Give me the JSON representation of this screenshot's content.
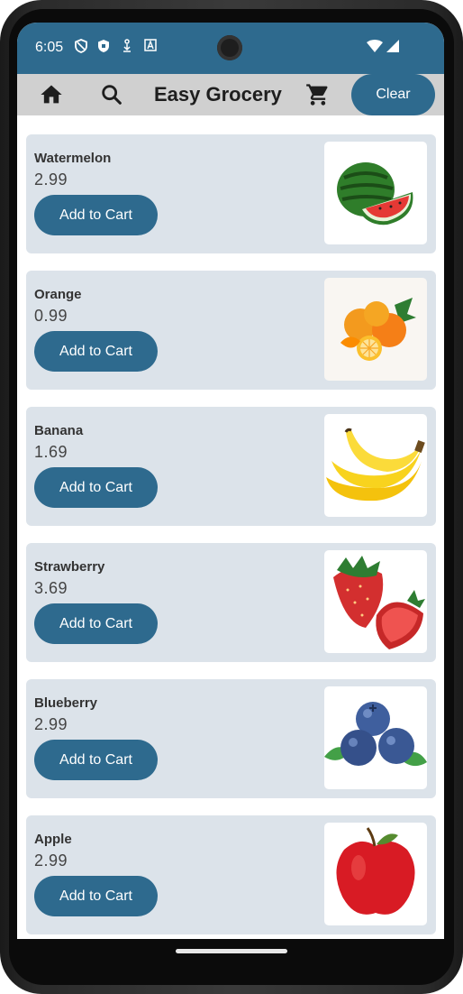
{
  "status_bar": {
    "time": "6:05"
  },
  "app_bar": {
    "title": "Easy Grocery",
    "clear_label": "Clear",
    "icons": [
      "home-icon",
      "search-icon",
      "cart-icon"
    ]
  },
  "products": [
    {
      "name": "Watermelon",
      "price": "2.99",
      "button": "Add to Cart",
      "image": "watermelon"
    },
    {
      "name": "Orange",
      "price": "0.99",
      "button": "Add to Cart",
      "image": "orange"
    },
    {
      "name": "Banana",
      "price": "1.69",
      "button": "Add to Cart",
      "image": "banana"
    },
    {
      "name": "Strawberry",
      "price": "3.69",
      "button": "Add to Cart",
      "image": "strawberry"
    },
    {
      "name": "Blueberry",
      "price": "2.99",
      "button": "Add to Cart",
      "image": "blueberry"
    },
    {
      "name": "Apple",
      "price": "2.99",
      "button": "Add to Cart",
      "image": "apple"
    }
  ],
  "colors": {
    "primary": "#2e6a8e",
    "card": "#dce3ea",
    "app_bar": "#d0d0d0"
  }
}
